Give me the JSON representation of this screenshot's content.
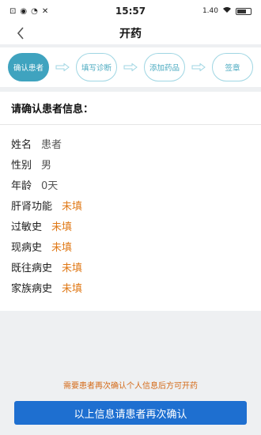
{
  "status_bar": {
    "time": "15:57",
    "network": "1.40"
  },
  "header": {
    "title": "开药"
  },
  "steps": [
    {
      "label": "确认患者",
      "active": true
    },
    {
      "label": "填写诊断",
      "active": false
    },
    {
      "label": "添加药品",
      "active": false
    },
    {
      "label": "签章",
      "active": false
    }
  ],
  "section": {
    "title": "请确认患者信息："
  },
  "info": [
    {
      "label": "姓名",
      "value": "患者",
      "pending": false
    },
    {
      "label": "性别",
      "value": "男",
      "pending": false
    },
    {
      "label": "年龄",
      "value": "0天",
      "pending": false
    },
    {
      "label": "肝肾功能",
      "value": "未填",
      "pending": true
    },
    {
      "label": "过敏史",
      "value": "未填",
      "pending": true
    },
    {
      "label": "现病史",
      "value": "未填",
      "pending": true
    },
    {
      "label": "既往病史",
      "value": "未填",
      "pending": true
    },
    {
      "label": "家族病史",
      "value": "未填",
      "pending": true
    }
  ],
  "footer": {
    "notice": "需要患者再次确认个人信息后方可开药",
    "confirm_label": "以上信息请患者再次确认"
  },
  "colors": {
    "accent": "#3fa3bf",
    "warning": "#e07a18",
    "primary_button": "#1e6fd0"
  }
}
